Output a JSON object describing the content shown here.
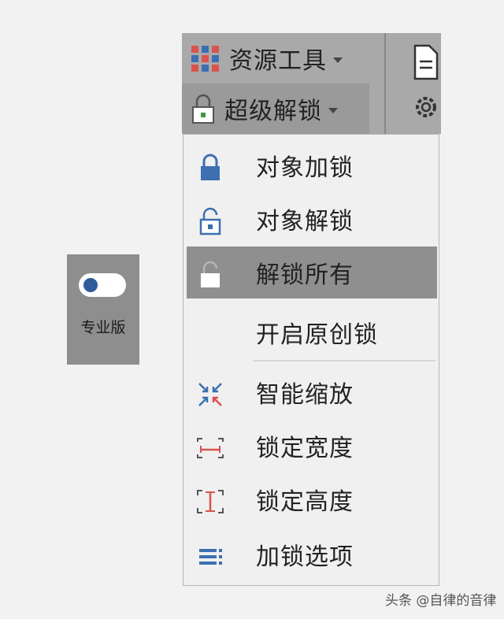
{
  "pro_tile": {
    "label": "专业版",
    "toggle_on": false
  },
  "ribbon": {
    "resource_tools": {
      "label": "资源工具",
      "icon": "grid-icon"
    },
    "super_unlock": {
      "label": "超级解锁",
      "icon": "padlock-icon"
    }
  },
  "menu": {
    "items": [
      {
        "label": "对象加锁",
        "icon": "lock-closed-icon"
      },
      {
        "label": "对象解锁",
        "icon": "lock-open-icon"
      },
      {
        "label": "解锁所有",
        "icon": "lock-open-white-icon",
        "highlighted": true
      },
      {
        "label": "开启原创锁",
        "icon": ""
      },
      {
        "label": "智能缩放",
        "icon": "smart-zoom-icon"
      },
      {
        "label": "锁定宽度",
        "icon": "lock-width-icon"
      },
      {
        "label": "锁定高度",
        "icon": "lock-height-icon"
      },
      {
        "label": "加锁选项",
        "icon": "lock-options-icon"
      }
    ]
  },
  "watermark": "头条 @自律的音律",
  "colors": {
    "accent_blue": "#3d6fb1",
    "accent_red": "#d9534f",
    "accent_green": "#3a9a3a",
    "highlight": "#8f8f8f"
  }
}
